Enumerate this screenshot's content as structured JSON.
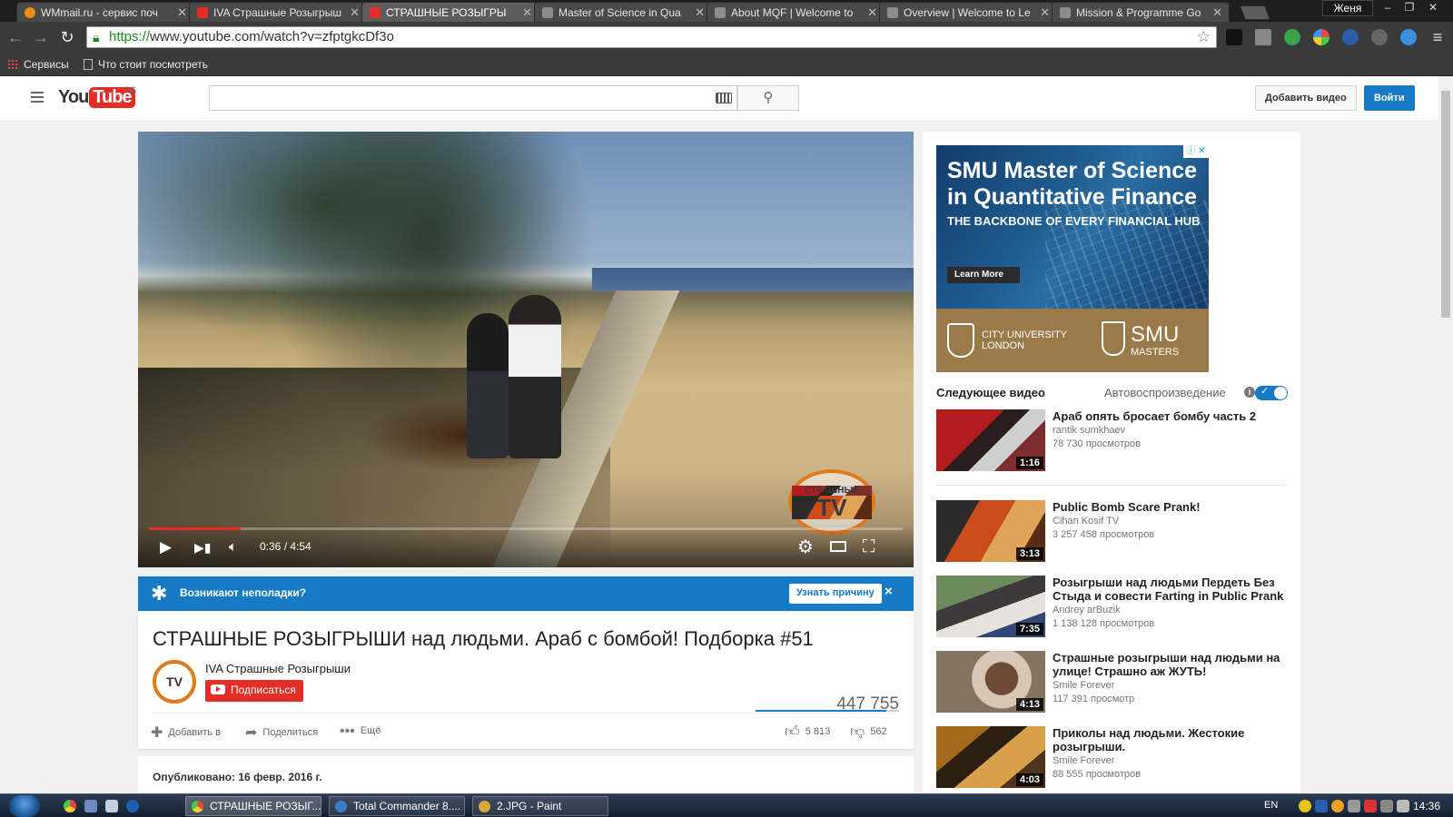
{
  "browser": {
    "tabs": [
      {
        "title": "WMmail.ru - сервис поч",
        "favicon": "orange-globe-icon",
        "active": false
      },
      {
        "title": "IVA Страшные Розыгрыш",
        "favicon": "youtube-icon",
        "active": false
      },
      {
        "title": "СТРАШНЫЕ РОЗЫГРЫ",
        "favicon": "youtube-icon",
        "active": true
      },
      {
        "title": "Master of Science in Qua",
        "favicon": "page-icon",
        "active": false
      },
      {
        "title": "About MQF | Welcome to",
        "favicon": "page-icon",
        "active": false
      },
      {
        "title": "Overview | Welcome to Le",
        "favicon": "page-icon",
        "active": false
      },
      {
        "title": "Mission & Programme Go",
        "favicon": "page-icon",
        "active": false
      }
    ],
    "tab_close_glyph": "✕",
    "user_name": "Женя",
    "window_buttons": {
      "minimize": "–",
      "maximize": "❐",
      "close": "✕"
    },
    "url": {
      "scheme": "https://",
      "rest": "www.youtube.com/watch?v=zfptgkcDf3o"
    },
    "bookmarks": [
      "Сервисы",
      "Что стоит посмотреть"
    ]
  },
  "youtube_header": {
    "logo_you": "You",
    "logo_tube": "Tube",
    "region": "SG",
    "search_placeholder": "",
    "upload_label": "Добавить видео",
    "signin_label": "Войти"
  },
  "player": {
    "time_display": "0:36 / 4:54",
    "played_fraction": 0.122,
    "watermark_line1": "СТРАШНЫЕ",
    "watermark_line2": "TV"
  },
  "trouble_banner": {
    "text": "Возникают неполадки?",
    "button": "Узнать причину",
    "close": "×"
  },
  "video": {
    "title": "СТРАШНЫЕ РОЗЫГРЫШИ над людьми. Араб с бомбой! Подборка #51",
    "channel_name": "IVA Страшные Розыгрыши",
    "channel_avatar_text": "TV",
    "subscribe_label": "Подписаться",
    "views": "447 755",
    "like_fraction": 0.912,
    "actions": {
      "add_to": "Добавить в",
      "share": "Поделиться",
      "more": "Ещё"
    },
    "likes": "5 813",
    "dislikes": "562",
    "published": "Опубликовано: 16 февр. 2016 г."
  },
  "ad": {
    "headline": "SMU Master of Science in Quantitative Finance",
    "tagline": "THE BACKBONE OF EVERY FINANCIAL HUB",
    "cta": "Learn More",
    "partner1": "CITY UNIVERSITY LONDON",
    "partner2": "SMU",
    "partner2_sub": "MASTERS"
  },
  "sidebar": {
    "upnext_label": "Следующее видео",
    "autoplay_label": "Автовоспроизведение",
    "autoplay_on": true,
    "recommendations": [
      {
        "title": "Араб опять бросает бомбу часть 2",
        "channel": "rantik sumkhaev",
        "views": "78 730 просмотров",
        "duration": "1:16"
      },
      {
        "title": "Public Bomb Scare Prank!",
        "channel": "Cihan Kosif TV",
        "views": "3 257 458 просмотров",
        "duration": "3:13"
      },
      {
        "title": "Розыгрыши над людьми Пердеть Без Стыда и совести Farting in Public Prank [",
        "channel": "Andrey arBuzik",
        "views": "1 138 128 просмотров",
        "duration": "7:35"
      },
      {
        "title": "Страшные розыгрыши над людьми на улице! Страшно аж ЖУТЬ!",
        "channel": "Smile Forever",
        "views": "117 391 просмотр",
        "duration": "4:13"
      },
      {
        "title": "Приколы над людьми. Жестокие розыгрыши.",
        "channel": "Smile Forever",
        "views": "88 555 просмотров",
        "duration": "4:03"
      }
    ]
  },
  "taskbar": {
    "tasks": [
      "СТРАШНЫЕ РОЗЫГ...",
      "Total Commander 8....",
      "2.JPG - Paint"
    ],
    "language": "EN",
    "clock": "14:36"
  }
}
